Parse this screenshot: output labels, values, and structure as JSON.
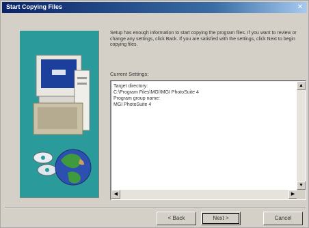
{
  "window": {
    "title": "Start Copying Files"
  },
  "intro": {
    "text": "Setup has enough information to start copying the program files. If you want to review or change any settings, click Back. If you are satisfied with the settings, click Next to begin copying files."
  },
  "settings": {
    "label": "Current Settings:",
    "lines": [
      "Target directory:",
      "C:\\Program Files\\MGI\\MGI PhotoSuite 4",
      "Program group name:",
      "MGI PhotoSuite 4"
    ]
  },
  "buttons": {
    "back": "< Back",
    "next": "Next >",
    "cancel": "Cancel"
  },
  "icons": {
    "close": "close-icon",
    "monitor": "computer-monitor-icon",
    "cds": "cd-discs-icon",
    "globe": "globe-icon"
  },
  "colors": {
    "graphic_background": "#2a9a9a",
    "titlebar": "#0a246a",
    "dialog": "#d4d0c8"
  }
}
